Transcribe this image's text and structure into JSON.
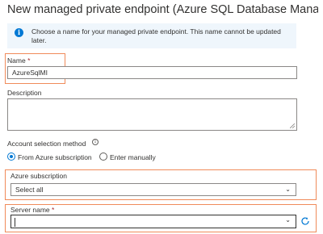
{
  "header": {
    "title": "New managed private endpoint (Azure SQL Database Managed Insta..."
  },
  "info_bar": {
    "text": "Choose a name for your managed private endpoint. This name cannot be updated later."
  },
  "name_field": {
    "label": "Name",
    "required_mark": "*",
    "value": "AzureSqlMI"
  },
  "description_field": {
    "label": "Description",
    "value": ""
  },
  "account_selection": {
    "label": "Account selection method",
    "options": [
      {
        "label": "From Azure subscription",
        "selected": true
      },
      {
        "label": "Enter manually",
        "selected": false
      }
    ]
  },
  "subscription_field": {
    "label": "Azure subscription",
    "value": "Select all"
  },
  "server_field": {
    "label": "Server name",
    "required_mark": "*",
    "value": ""
  },
  "colors": {
    "highlight": "#f08b5a",
    "accent": "#0078d4",
    "info_bg": "#eff6fc"
  }
}
